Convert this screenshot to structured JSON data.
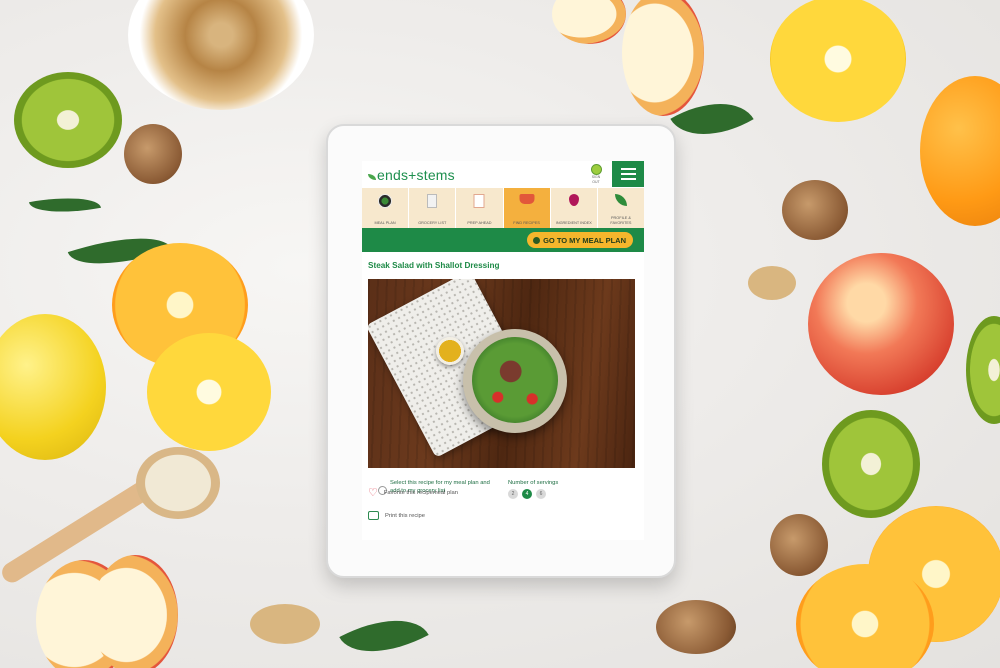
{
  "app": {
    "logo_text": "ends+stems",
    "sign_out": "SIGN OUT"
  },
  "nav": {
    "items": [
      {
        "label": "MEAL PLAN",
        "icon": "plate-icon",
        "active": false
      },
      {
        "label": "GROCERY LIST",
        "icon": "list-icon",
        "active": false
      },
      {
        "label": "PREP AHEAD",
        "icon": "prep-icon",
        "active": false
      },
      {
        "label": "FIND RECIPES",
        "icon": "pot-icon",
        "active": true
      },
      {
        "label": "INGREDIENT INDEX",
        "icon": "beet-icon",
        "active": false
      },
      {
        "label": "PROFILE & FAVORITES",
        "icon": "leaf-icon",
        "active": false
      }
    ]
  },
  "toolbar": {
    "goto_label": "GO TO MY MEAL PLAN"
  },
  "recipe": {
    "title": "Steak Salad with Shallot Dressing",
    "select_text": "Select this recipe for my meal plan and add to my grocery list",
    "servings_label": "Number of servings",
    "servings_options": [
      "2",
      "4",
      "6"
    ],
    "servings_selected": "4",
    "favorite_text": "Favorite this recipemeal plan",
    "print_text": "Print this recipe"
  },
  "colors": {
    "brand_green": "#1e8a47",
    "accent_yellow": "#f5b62c",
    "nav_bg": "#f7e8cd",
    "nav_active": "#f4b03e"
  }
}
